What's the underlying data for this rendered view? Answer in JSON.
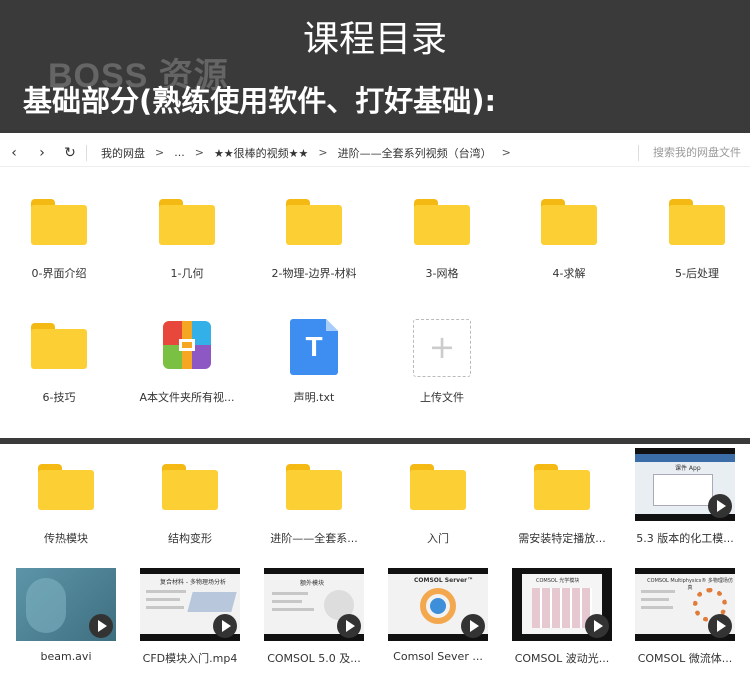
{
  "banner": {
    "title": "课程目录",
    "watermark": "BOSS 资源",
    "subtitle": "基础部分(熟练使用软件、打好基础):"
  },
  "navbar": {
    "back": "‹",
    "forward": "›",
    "refresh": "↻",
    "breadcrumbs": [
      "我的网盘",
      "...",
      "★★很棒的视频★★",
      "进阶——全套系列视频（台湾）"
    ],
    "separator": ">",
    "search_placeholder": "搜索我的网盘文件"
  },
  "panel1_items": [
    {
      "label": "0-界面介绍",
      "icon": "folder-icon"
    },
    {
      "label": "1-几何",
      "icon": "folder-icon"
    },
    {
      "label": "2-物理-边界-材料",
      "icon": "folder-icon"
    },
    {
      "label": "3-网格",
      "icon": "folder-icon"
    },
    {
      "label": "4-求解",
      "icon": "folder-icon"
    },
    {
      "label": "5-后处理",
      "icon": "folder-icon"
    },
    {
      "label": "6-技巧",
      "icon": "folder-icon"
    },
    {
      "label": "A本文件夹所有视...",
      "icon": "archive-icon"
    },
    {
      "label": "声明.txt",
      "icon": "text-file-icon",
      "glyph": "T"
    },
    {
      "label": "上传文件",
      "icon": "upload-plus-icon",
      "glyph": "+"
    }
  ],
  "panel2_items": [
    {
      "label": "传热模块",
      "icon": "folder-icon"
    },
    {
      "label": "结构变形",
      "icon": "folder-icon"
    },
    {
      "label": "进阶——全套系...",
      "icon": "folder-icon"
    },
    {
      "label": "入门",
      "icon": "folder-icon"
    },
    {
      "label": "需安装特定播放...",
      "icon": "folder-icon"
    },
    {
      "label": "5.3 版本的化工模...",
      "icon": "video-thumbnail"
    },
    {
      "label": "beam.avi",
      "icon": "video-thumbnail"
    },
    {
      "label": "CFD模块入门.mp4",
      "icon": "video-thumbnail"
    },
    {
      "label": "COMSOL 5.0 及...",
      "icon": "video-thumbnail"
    },
    {
      "label": "Comsol Sever ...",
      "icon": "video-thumbnail"
    },
    {
      "label": "COMSOL 波动光...",
      "icon": "video-thumbnail"
    },
    {
      "label": "COMSOL 微流体...",
      "icon": "video-thumbnail"
    }
  ],
  "thumb_texts": {
    "t1": "课件 App",
    "t4": "复合材料 - 多物理场分析",
    "t5": "额外模块",
    "t6": "COMSOL Server™",
    "t7": "COMSOL 光学模块",
    "t8": "COMSOL Multiphysics® 多物理场仿真"
  },
  "colors": {
    "banner_bg": "#3a3a3a",
    "folder_body": "#fcd035",
    "folder_tab": "#f5b914",
    "txt_blue": "#3d8ef0",
    "play_button": "#333333"
  }
}
